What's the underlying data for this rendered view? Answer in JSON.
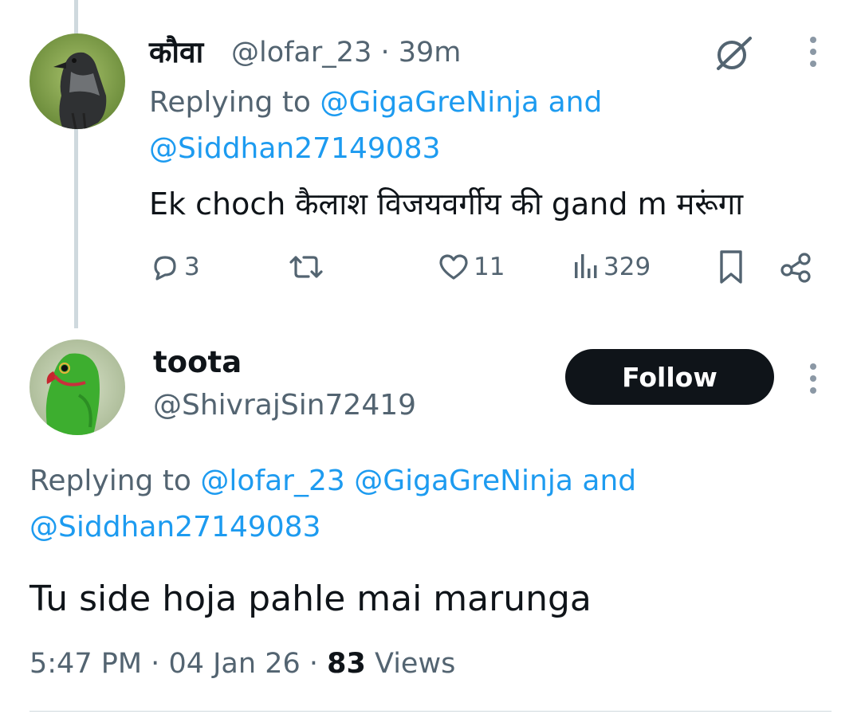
{
  "tweet1": {
    "display_name": "कौवा",
    "handle": "@lofar_23",
    "separator": "·",
    "time": "39m",
    "replying_prefix": "Replying to",
    "reply_link_1": "@GigaGreNinja",
    "reply_and": "and",
    "reply_link_2": "@Siddhan27149083",
    "text": "Ek choch कैलाश विजयवर्गीय की gand m मरूंगा",
    "replies": "3",
    "likes": "11",
    "views": "329",
    "icons": [
      "grok-icon",
      "more-icon",
      "reply-icon",
      "retweet-icon",
      "like-icon",
      "views-icon",
      "bookmark-icon",
      "share-icon"
    ]
  },
  "tweet2": {
    "display_name": "toota",
    "handle": "@ShivrajSin72419",
    "follow_label": "Follow",
    "replying_prefix": "Replying to",
    "reply_link_1": "@lofar_23",
    "reply_link_2": "@GigaGreNinja",
    "reply_and": "and",
    "reply_link_3": "@Siddhan27149083",
    "text": "Tu side hoja pahle mai marunga",
    "time": "5:47 PM",
    "separator": "·",
    "date": "04 Jan 26",
    "views_count": "83",
    "views_label": "Views"
  },
  "colors": {
    "link": "#1d9bf0",
    "secondary_text": "#536471",
    "primary_text": "#0f1419",
    "follow_bg": "#0f1419"
  }
}
